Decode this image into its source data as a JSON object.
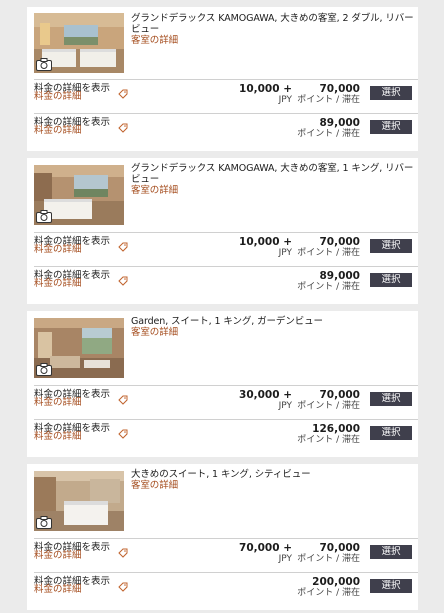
{
  "rooms": [
    {
      "title": "グランドデラックス KAMOGAWA, 大きめの客室, 2 ダブル, リバービュー",
      "detail_link": "客室の詳細",
      "rates": [
        {
          "link_line1": "料金の詳細を表示",
          "link_line2": "料金の詳細",
          "cash": "10,000 +",
          "cash_unit": "JPY",
          "points": "70,000",
          "points_unit": "ポイント / 滞在",
          "select": "選択"
        },
        {
          "link_line1": "料金の詳細を表示",
          "link_line2": "料金の詳細",
          "cash": "",
          "cash_unit": "",
          "points": "89,000",
          "points_unit": "ポイント / 滞在",
          "select": "選択"
        }
      ]
    },
    {
      "title": "グランドデラックス KAMOGAWA, 大きめの客室, 1 キング, リバービュー",
      "detail_link": "客室の詳細",
      "rates": [
        {
          "link_line1": "料金の詳細を表示",
          "link_line2": "料金の詳細",
          "cash": "10,000 +",
          "cash_unit": "JPY",
          "points": "70,000",
          "points_unit": "ポイント / 滞在",
          "select": "選択"
        },
        {
          "link_line1": "料金の詳細を表示",
          "link_line2": "料金の詳細",
          "cash": "",
          "cash_unit": "",
          "points": "89,000",
          "points_unit": "ポイント / 滞在",
          "select": "選択"
        }
      ]
    },
    {
      "title": "Garden, スイート, 1 キング, ガーデンビュー",
      "detail_link": "客室の詳細",
      "rates": [
        {
          "link_line1": "料金の詳細を表示",
          "link_line2": "料金の詳細",
          "cash": "30,000 +",
          "cash_unit": "JPY",
          "points": "70,000",
          "points_unit": "ポイント / 滞在",
          "select": "選択"
        },
        {
          "link_line1": "料金の詳細を表示",
          "link_line2": "料金の詳細",
          "cash": "",
          "cash_unit": "",
          "points": "126,000",
          "points_unit": "ポイント / 滞在",
          "select": "選択"
        }
      ]
    },
    {
      "title": "大きめのスイート, 1 キング, シティビュー",
      "detail_link": "客室の詳細",
      "rates": [
        {
          "link_line1": "料金の詳細を表示",
          "link_line2": "料金の詳細",
          "cash": "70,000 +",
          "cash_unit": "JPY",
          "points": "70,000",
          "points_unit": "ポイント / 滞在",
          "select": "選択"
        },
        {
          "link_line1": "料金の詳細を表示",
          "link_line2": "料金の詳細",
          "cash": "",
          "cash_unit": "",
          "points": "200,000",
          "points_unit": "ポイント / 滞在",
          "select": "選択"
        }
      ]
    }
  ],
  "colors": {
    "link": "#a44c1d",
    "button": "#3f3f4c",
    "background": "#ebebeb"
  },
  "icons": [
    "camera-icon",
    "tag-icon"
  ]
}
